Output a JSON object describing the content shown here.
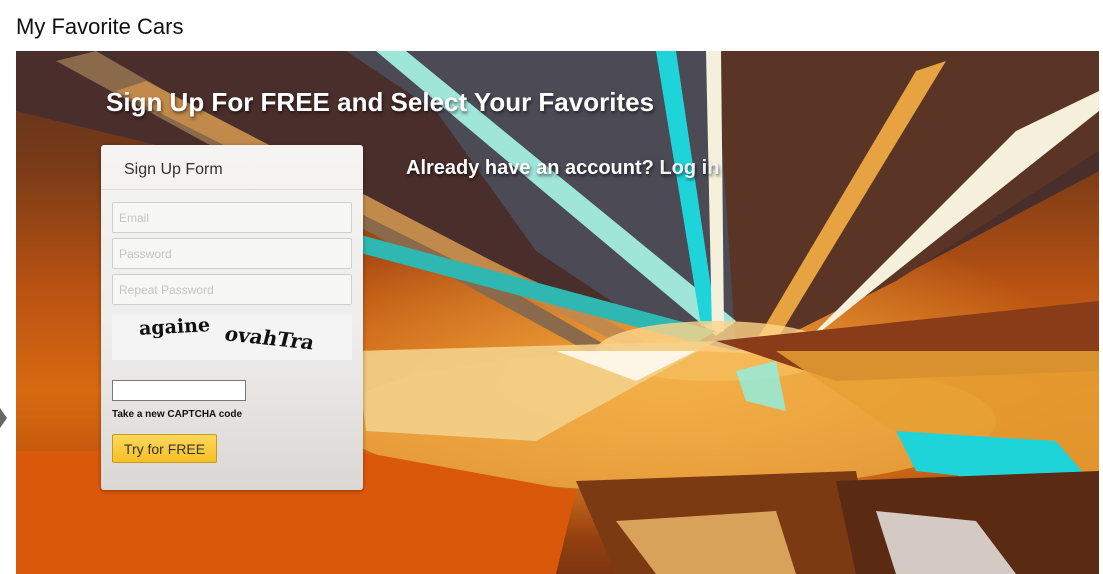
{
  "page": {
    "title": "My Favorite Cars"
  },
  "hero": {
    "headline": "Sign Up For FREE and Select Your Favorites",
    "login_prompt": "Already have an account?",
    "login_link": "Log in"
  },
  "signup_form": {
    "title": "Sign Up Form",
    "email_placeholder": "Email",
    "password_placeholder": "Password",
    "repeat_password_placeholder": "Repeat Password",
    "captcha_words": [
      "againe",
      "ovahTra"
    ],
    "captcha_input_value": "",
    "captcha_refresh_label": "Take a new CAPTCHA code",
    "submit_label": "Try for FREE"
  },
  "colors": {
    "button_yellow": "#f6bf24",
    "hero_orange": "#d86a10",
    "streak_cyan": "#1fd4d9"
  }
}
